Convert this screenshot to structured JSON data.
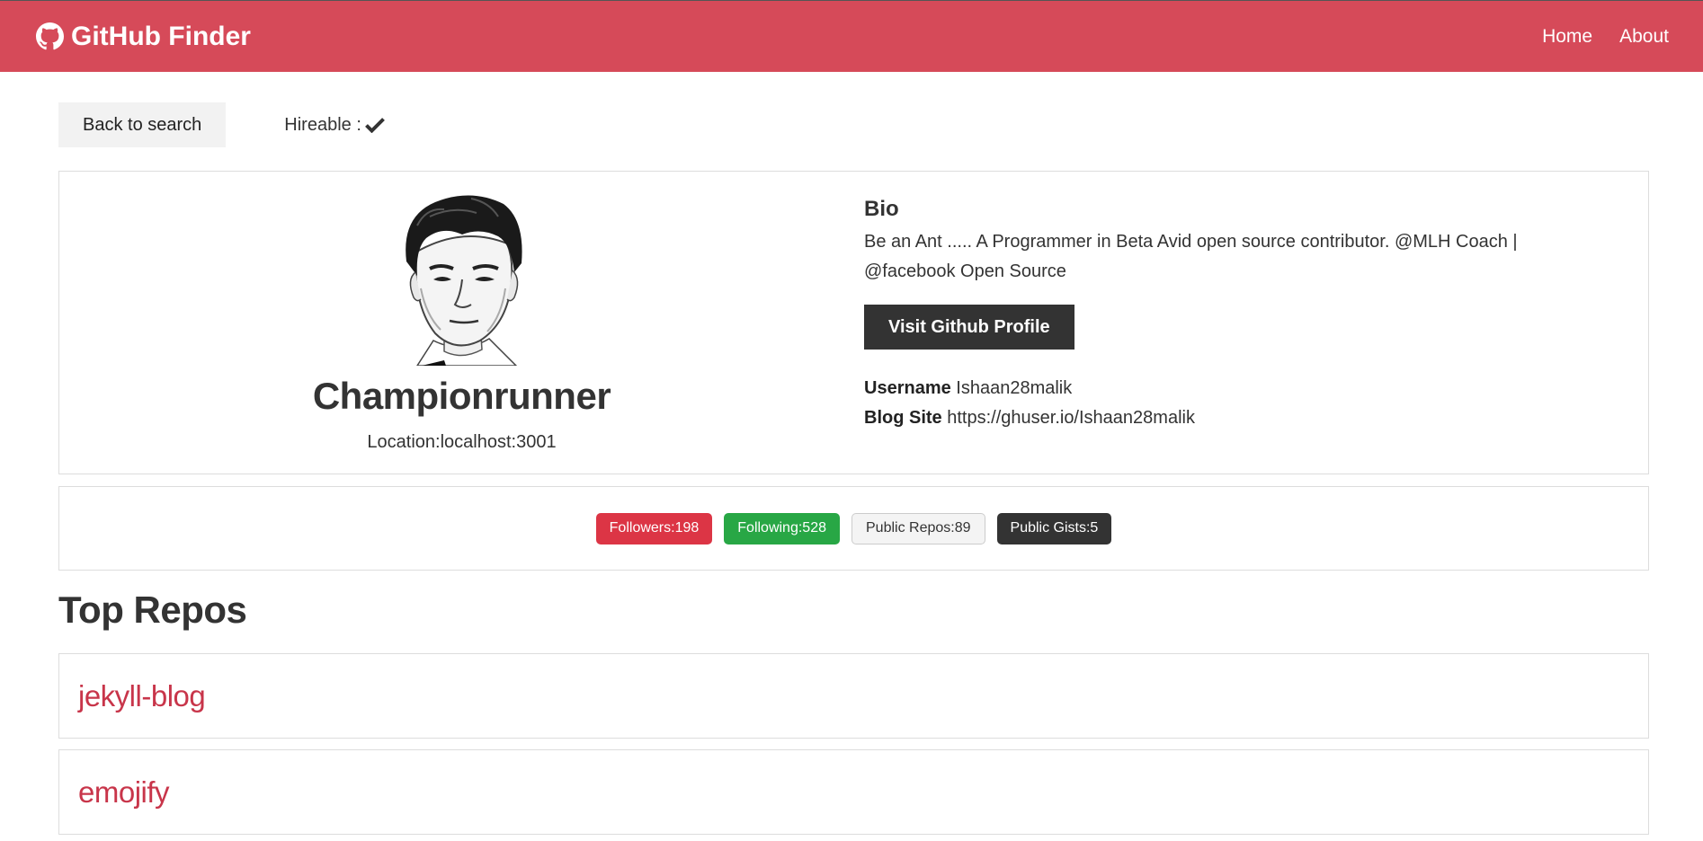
{
  "navbar": {
    "brand": "GitHub Finder",
    "brand_icon": "github-icon",
    "links": [
      "Home",
      "About"
    ]
  },
  "actions": {
    "back_label": "Back to search",
    "hireable_label": "Hireable :",
    "hireable_icon": "check-icon"
  },
  "profile": {
    "name": "Championrunner",
    "location": "Location:localhost:3001",
    "bio_title": "Bio",
    "bio": "Be an Ant ..... A Programmer in Beta Avid open source contributor. @MLH Coach | @facebook Open Source",
    "visit_label": "Visit Github Profile",
    "username_label": "Username",
    "username": "Ishaan28malik",
    "blog_label": "Blog Site",
    "blog": "https://ghuser.io/Ishaan28malik"
  },
  "badges": [
    {
      "text": "Followers:198",
      "color": "#dc3545"
    },
    {
      "text": "Following:528",
      "color": "#28a745"
    },
    {
      "text": "Public Repos:89",
      "color": "#f4f4f4"
    },
    {
      "text": "Public Gists:5",
      "color": "#333333"
    }
  ],
  "repos": {
    "title": "Top Repos",
    "items": [
      "jekyll-blog",
      "emojify"
    ]
  },
  "colors": {
    "primary": "#d64a59",
    "repo_link": "#c8354a",
    "dark": "#333333"
  }
}
